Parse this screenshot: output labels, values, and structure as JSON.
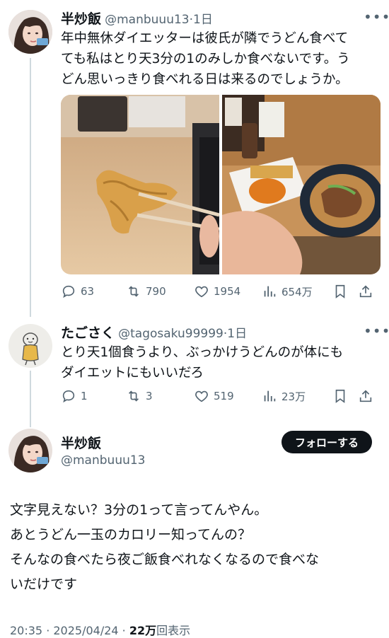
{
  "tweet1": {
    "name": "半炒飯",
    "handle": "@manbuuu13",
    "time": "·1日",
    "text_lines": [
      "年中無休ダイエッターは彼氏が隣でうどん食べて",
      "ても私はとり天3分の1のみしか食べないです。う",
      "どん思いっきり食べれる日は来るのでしょうか。"
    ],
    "more": "•••",
    "actions": {
      "replies": "63",
      "retweets": "790",
      "likes": "1954",
      "views": "654万"
    }
  },
  "tweet2": {
    "name": "たごさく",
    "handle": "@tagosaku99999",
    "time": "·1日",
    "text_lines": [
      "とり天1個食うより、ぶっかけうどんのが体にも",
      "ダイエットにもいいだろ"
    ],
    "more": "•••",
    "actions": {
      "replies": "1",
      "retweets": "3",
      "likes": "519",
      "views": "23万"
    }
  },
  "tweet3": {
    "name": "半炒飯",
    "handle": "@manbuuu13",
    "follow_label": "フォローする",
    "text_lines": [
      "文字見えない？3分の1って言ってんやん。",
      "あとうどん一玉のカロリー知ってんの？",
      "そんなの食べたら夜ご飯食べれなくなるので食べな",
      "いだけです"
    ],
    "footer": {
      "time": "20:35 · 2025/04/24 · ",
      "views_count": "22万",
      "views_label": "回表示"
    }
  },
  "colors": {
    "text": "#0f1419",
    "secondary": "#536471",
    "thread": "#cfd9de",
    "button": "#0f1419"
  },
  "icons": [
    "reply-icon",
    "retweet-icon",
    "like-icon",
    "views-icon",
    "bookmark-icon",
    "share-icon"
  ]
}
